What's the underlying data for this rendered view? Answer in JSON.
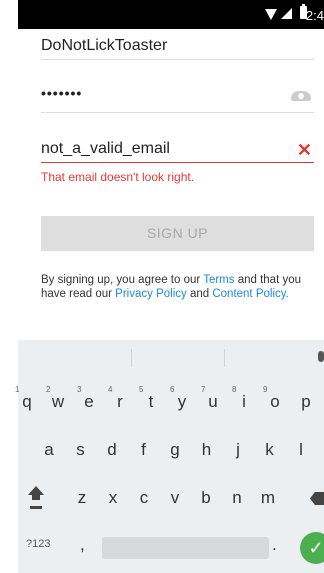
{
  "status_bar": {
    "time": "2:4"
  },
  "form": {
    "username": "DoNotLickToaster",
    "password": "•••••••",
    "email": "not_a_valid_email",
    "email_error": "That email doesn't look right.",
    "signup_label": "SIGN UP",
    "terms_prefix": "By signing up, you agree to our",
    "terms_link": "Terms",
    "terms_middle": "and that you have read our",
    "privacy_link": "Privacy Policy",
    "and": "and",
    "content_link": "Content Policy."
  },
  "keyboard": {
    "row1": [
      "q",
      "w",
      "e",
      "r",
      "t",
      "y",
      "u",
      "i",
      "o",
      "p"
    ],
    "row1_hints": [
      "1",
      "2",
      "3",
      "4",
      "5",
      "6",
      "7",
      "8",
      "9",
      ""
    ],
    "row2": [
      "a",
      "s",
      "d",
      "f",
      "g",
      "h",
      "j",
      "k",
      "l"
    ],
    "row3": [
      "z",
      "x",
      "c",
      "v",
      "b",
      "n",
      "m"
    ],
    "sym_label": "?123",
    "comma": ",",
    "period": ".",
    "done_label": "✓"
  }
}
